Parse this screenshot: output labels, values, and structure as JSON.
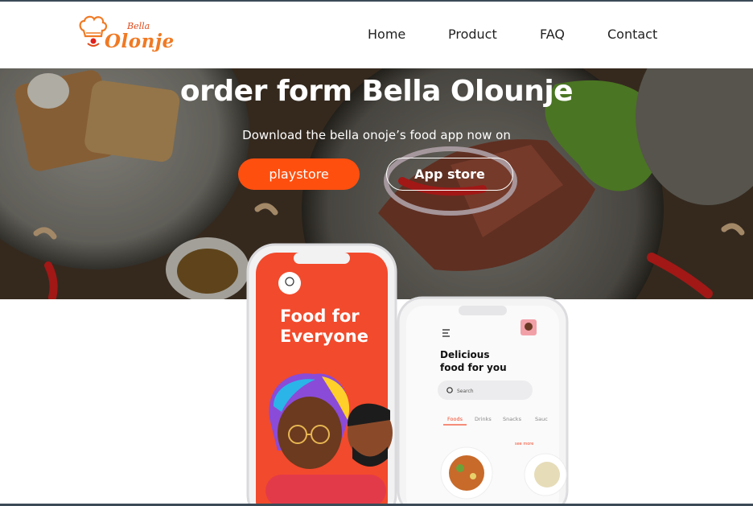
{
  "brand": {
    "bella": "Bella",
    "olonje": "Olonje"
  },
  "nav": {
    "items": [
      {
        "label": "Home"
      },
      {
        "label": "Product"
      },
      {
        "label": "FAQ"
      },
      {
        "label": "Contact"
      }
    ]
  },
  "hero": {
    "title": "order form Bella Olounje",
    "subtitle": "Download the bella onoje’s food app now on",
    "playstore_label": "playstore",
    "appstore_label": "App store"
  },
  "phone_left": {
    "headline_line1": "Food for",
    "headline_line2": "Everyone"
  },
  "phone_right": {
    "heading_line1": "Delicious",
    "heading_line2": "food for you",
    "search_placeholder": "Search",
    "tabs": [
      "Foods",
      "Drinks",
      "Snacks",
      "Sauc"
    ],
    "see_more": "see more"
  },
  "colors": {
    "accent": "#ff4f0f",
    "phone_red": "#f24a2c",
    "dark_bar": "#3b4a56"
  }
}
